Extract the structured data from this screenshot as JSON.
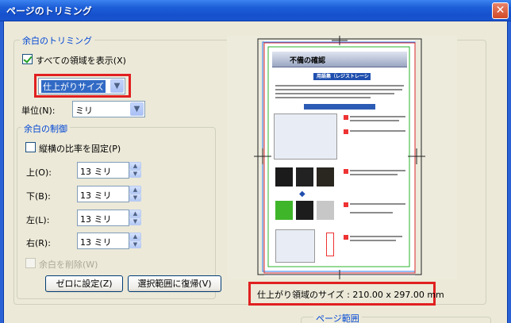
{
  "window": {
    "title": "ページのトリミング",
    "close_glyph": "✕"
  },
  "trim_group": {
    "legend": "余白のトリミング"
  },
  "show_all_boxes": {
    "label": "すべての領域を表示(X)",
    "checked": true
  },
  "box_select": {
    "value": "仕上がりサイズ",
    "arrow": "▼"
  },
  "units": {
    "label": "単位(N):",
    "value": "ミリ",
    "arrow": "▼"
  },
  "margin_controls": {
    "legend": "余白の制御",
    "constrain": {
      "label": "縦横の比率を固定(P)",
      "checked": false
    },
    "fields": [
      {
        "label": "上(O):",
        "value": "13 ミリ"
      },
      {
        "label": "下(B):",
        "value": "13 ミリ"
      },
      {
        "label": "左(L):",
        "value": "13 ミリ"
      },
      {
        "label": "右(R):",
        "value": "13 ミリ"
      }
    ],
    "remove_white": {
      "label": "余白を削除(W)",
      "checked": false,
      "disabled": true
    }
  },
  "buttons": {
    "set_zero": "ゼロに設定(Z)",
    "revert": "選択範囲に復帰(V)"
  },
  "preview": {
    "page_title": "不備の確認",
    "page_subtitle": "用語集（レジストレーション）",
    "size_caption": "仕上がり領域のサイズ : 210.00 x 297.00 mm"
  },
  "page_range": {
    "legend": "ページ範囲"
  },
  "colors": {
    "title_bar": "#1d5fd8",
    "highlight": "#e02020",
    "group_legend": "#0046d5"
  }
}
